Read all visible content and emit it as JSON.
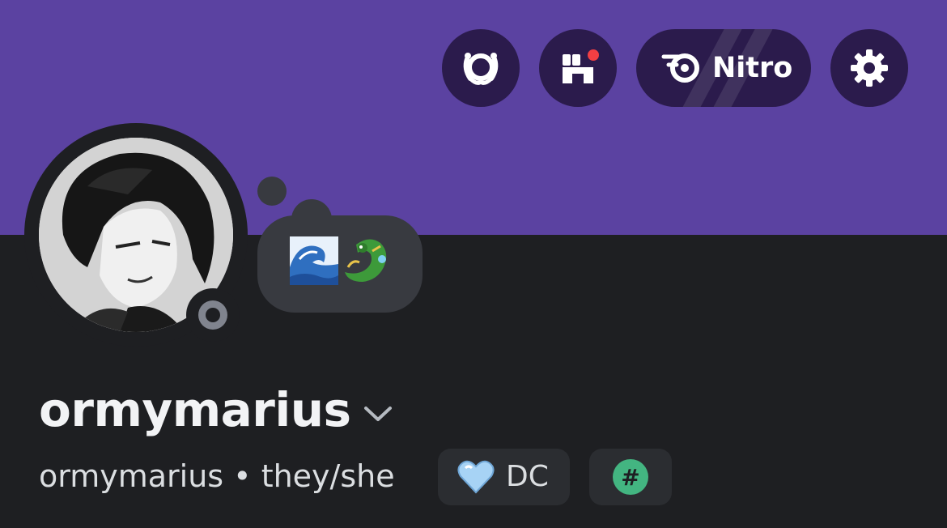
{
  "profile": {
    "display_name": "ormymarius",
    "username": "ormymarius",
    "separator": "•",
    "pronouns": "they/she",
    "status_bubble_emoji": "🌊🐉",
    "status": "offline"
  },
  "header": {
    "nitro_label": "Nitro"
  },
  "tags": {
    "clan_tag": "DC",
    "clan_icon": "light-blue-heart",
    "tag_icon": "#"
  },
  "colors": {
    "banner": "#5b42a1",
    "button_bg": "#2b1b4c",
    "body_bg": "#1e1f22",
    "bubble_bg": "#383a40",
    "notification_dot": "#f23f43",
    "hash_badge": "#43b581"
  },
  "icons": {
    "quests": "laurel-wreath-icon",
    "shop": "shop-icon",
    "nitro": "nitro-icon",
    "settings": "gear-icon",
    "name_dropdown": "chevron-down-icon",
    "status": "offline-status-icon"
  }
}
